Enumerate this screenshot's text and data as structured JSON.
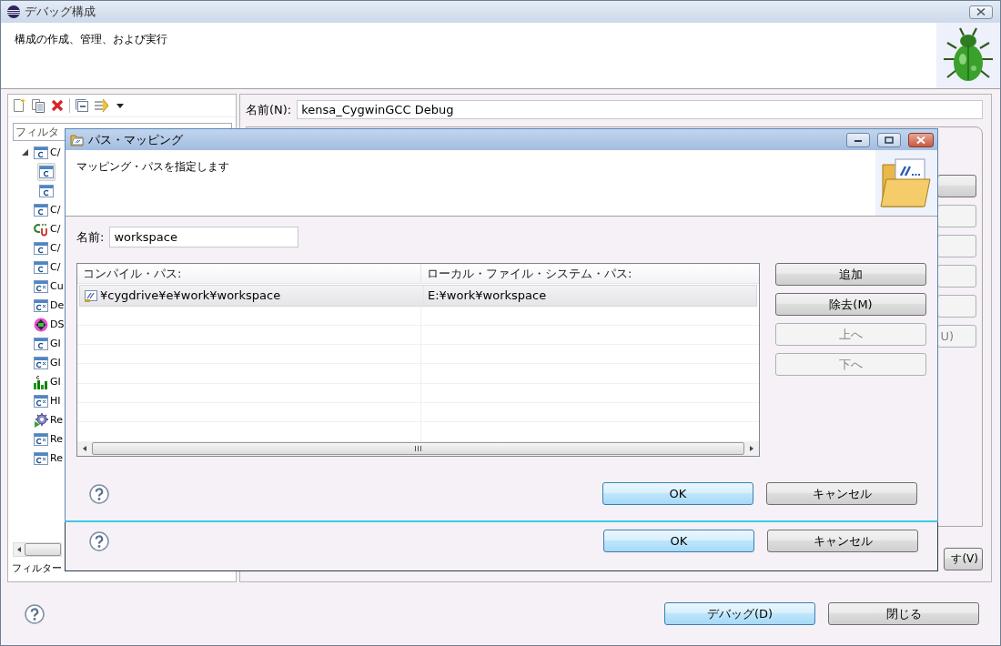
{
  "window": {
    "title": "デバッグ構成"
  },
  "header": {
    "message": "構成の作成、管理、および実行"
  },
  "sidebar": {
    "filter_placeholder": "フィルタ",
    "tree": [
      {
        "label": "C/",
        "kind": "c",
        "selected": false,
        "expanded": true,
        "children": [
          {
            "kind": "c",
            "selected": true
          },
          {
            "kind": "c",
            "selected": false
          }
        ]
      },
      {
        "label": "C/",
        "kind": "c",
        "selected": false
      },
      {
        "label": "C/",
        "kind": "cu",
        "selected": false
      },
      {
        "label": "C/",
        "kind": "c",
        "selected": false
      },
      {
        "label": "C/",
        "kind": "c",
        "selected": false
      },
      {
        "label": "Cu",
        "kind": "cx",
        "selected": false
      },
      {
        "label": "De",
        "kind": "cx",
        "selected": false
      },
      {
        "label": "DS",
        "kind": "ds",
        "selected": false
      },
      {
        "label": "GI",
        "kind": "c",
        "selected": false
      },
      {
        "label": "GI",
        "kind": "cx",
        "selected": false
      },
      {
        "label": "GI",
        "kind": "gl",
        "selected": false
      },
      {
        "label": "HI",
        "kind": "cx",
        "selected": false
      },
      {
        "label": "Re",
        "kind": "re",
        "selected": false
      },
      {
        "label": "Re",
        "kind": "cx",
        "selected": false
      },
      {
        "label": "Re",
        "kind": "cx",
        "selected": false
      }
    ],
    "status": "フィルター"
  },
  "config": {
    "name_label": "名前(N):",
    "name_value": "kensa_CygwinGCC Debug",
    "side_buttons": [
      {
        "disabled": false
      },
      {
        "disabled": true
      },
      {
        "disabled": true
      },
      {
        "disabled": true
      },
      {
        "disabled": true
      },
      {
        "label": "U)",
        "disabled": true
      }
    ],
    "bottom_buttons": [
      {
        "label": "す(V)"
      }
    ]
  },
  "footer": {
    "buttons": [
      {
        "label": "デバッグ(D)",
        "default": true
      },
      {
        "label": "閉じる",
        "default": false
      }
    ]
  },
  "back_dialog": {
    "buttons": [
      {
        "label": "OK",
        "default": true
      },
      {
        "label": "キャンセル",
        "default": false
      }
    ]
  },
  "dialog": {
    "title": "パス・マッピング",
    "message": "マッピング・パスを指定します",
    "name_label": "名前:",
    "name_value": "workspace",
    "table": {
      "columns": [
        "コンパイル・パス:",
        "ローカル・ファイル・システム・パス:"
      ],
      "rows": [
        {
          "cells": [
            "¥cygdrive¥e¥work¥workspace",
            "E:¥work¥workspace"
          ],
          "selected": true
        }
      ]
    },
    "side_buttons": [
      {
        "label": "追加",
        "disabled": false
      },
      {
        "label": "除去(M)",
        "disabled": false
      },
      {
        "label": "上へ",
        "disabled": true
      },
      {
        "label": "下へ",
        "disabled": true
      }
    ],
    "buttons": [
      {
        "label": "OK",
        "default": true
      },
      {
        "label": "キャンセル",
        "default": false
      }
    ]
  }
}
